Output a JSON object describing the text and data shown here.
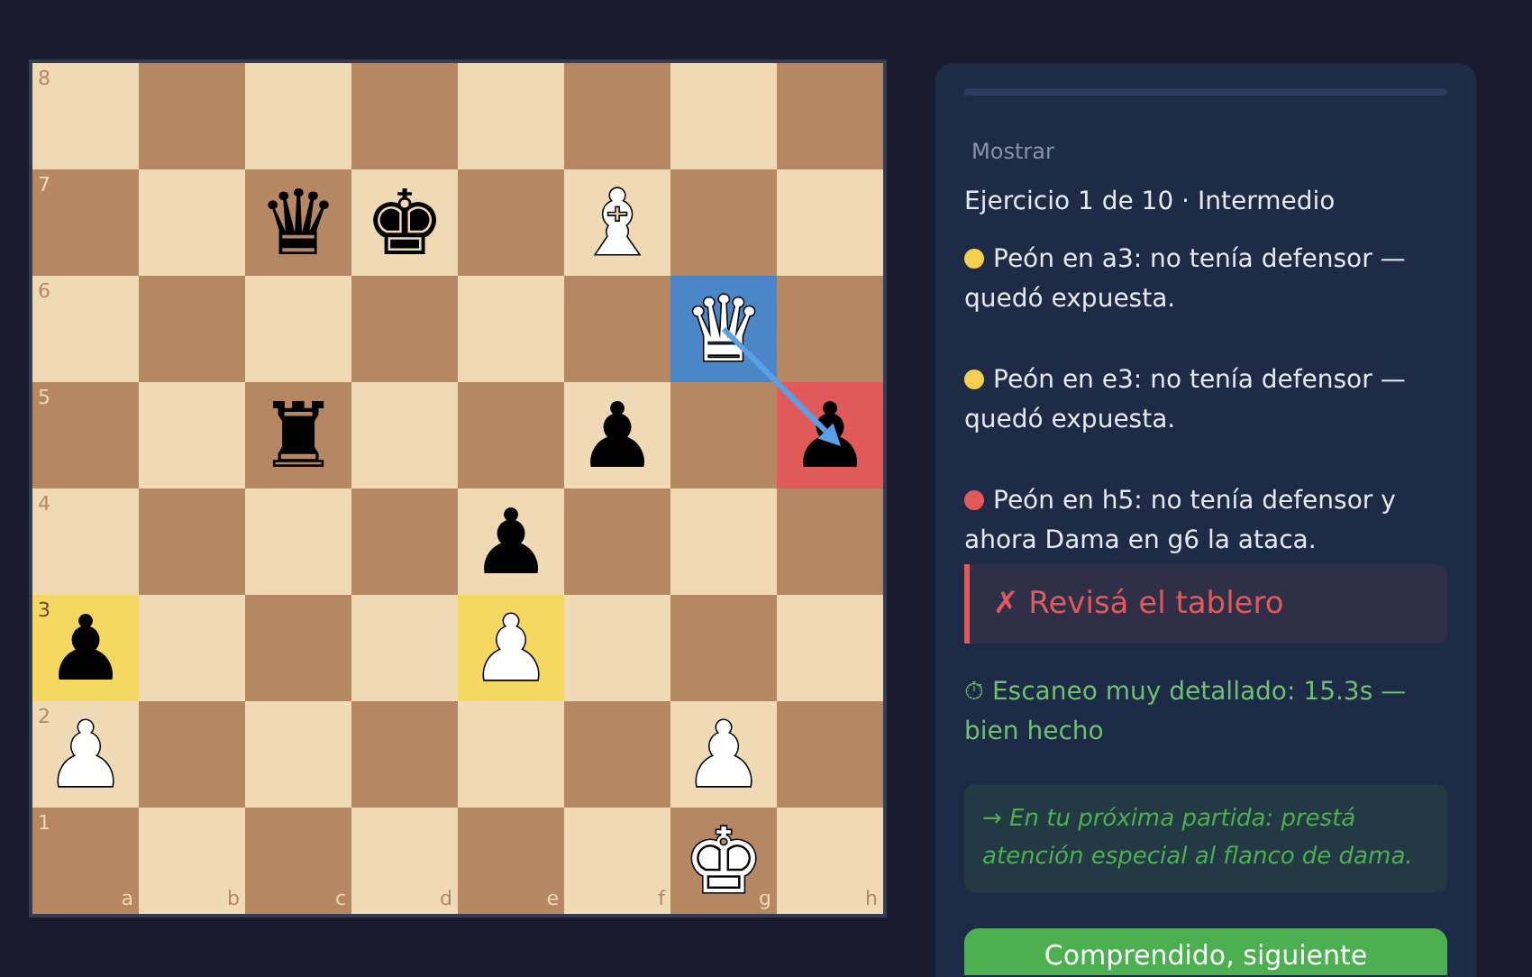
{
  "board": {
    "files": [
      "a",
      "b",
      "c",
      "d",
      "e",
      "f",
      "g",
      "h"
    ],
    "rows": [
      {
        "rank": "8",
        "squares": [
          {
            "color": "#f0d9b5"
          },
          {
            "color": "#b58863"
          },
          {
            "color": "#f0d9b5"
          },
          {
            "color": "#b58863"
          },
          {
            "color": "#f0d9b5"
          },
          {
            "color": "#b58863"
          },
          {
            "color": "#f0d9b5"
          },
          {
            "color": "#b58863"
          }
        ]
      },
      {
        "rank": "7",
        "squares": [
          {
            "color": "#b58863"
          },
          {
            "color": "#f0d9b5"
          },
          {
            "color": "#b58863",
            "piece": "♛",
            "kind": "black"
          },
          {
            "color": "#f0d9b5",
            "piece": "♚",
            "kind": "black"
          },
          {
            "color": "#b58863"
          },
          {
            "color": "#f0d9b5",
            "piece": "♝",
            "kind": "white"
          },
          {
            "color": "#b58863"
          },
          {
            "color": "#f0d9b5"
          }
        ]
      },
      {
        "rank": "6",
        "squares": [
          {
            "color": "#f0d9b5"
          },
          {
            "color": "#b58863"
          },
          {
            "color": "#f0d9b5"
          },
          {
            "color": "#b58863"
          },
          {
            "color": "#f0d9b5"
          },
          {
            "color": "#b58863"
          },
          {
            "color": "#4a86c8",
            "piece": "♛",
            "kind": "white",
            "arrow_from": true
          },
          {
            "color": "#b58863"
          }
        ]
      },
      {
        "rank": "5",
        "squares": [
          {
            "color": "#b58863"
          },
          {
            "color": "#f0d9b5"
          },
          {
            "color": "#b58863",
            "piece": "♜",
            "kind": "black"
          },
          {
            "color": "#f0d9b5"
          },
          {
            "color": "#b58863"
          },
          {
            "color": "#f0d9b5",
            "piece": "♟",
            "kind": "black"
          },
          {
            "color": "#b58863"
          },
          {
            "color": "#e05a5a",
            "piece": "♟",
            "kind": "black",
            "arrow_to": true
          }
        ]
      },
      {
        "rank": "4",
        "squares": [
          {
            "color": "#f0d9b5"
          },
          {
            "color": "#b58863"
          },
          {
            "color": "#f0d9b5"
          },
          {
            "color": "#b58863"
          },
          {
            "color": "#f0d9b5",
            "piece": "♟",
            "kind": "black"
          },
          {
            "color": "#b58863"
          },
          {
            "color": "#f0d9b5"
          },
          {
            "color": "#b58863"
          }
        ]
      },
      {
        "rank": "3",
        "squares": [
          {
            "color": "#f5d860",
            "piece": "♟",
            "kind": "black"
          },
          {
            "color": "#f0d9b5"
          },
          {
            "color": "#b58863"
          },
          {
            "color": "#f0d9b5"
          },
          {
            "color": "#f5d860",
            "piece": "♟",
            "kind": "white"
          },
          {
            "color": "#f0d9b5"
          },
          {
            "color": "#b58863"
          },
          {
            "color": "#f0d9b5"
          }
        ]
      },
      {
        "rank": "2",
        "squares": [
          {
            "color": "#f0d9b5",
            "piece": "♟",
            "kind": "white"
          },
          {
            "color": "#b58863"
          },
          {
            "color": "#f0d9b5"
          },
          {
            "color": "#b58863"
          },
          {
            "color": "#f0d9b5"
          },
          {
            "color": "#b58863"
          },
          {
            "color": "#f0d9b5",
            "piece": "♟",
            "kind": "white"
          },
          {
            "color": "#b58863"
          }
        ]
      },
      {
        "rank": "1",
        "squares": [
          {
            "color": "#b58863"
          },
          {
            "color": "#f0d9b5"
          },
          {
            "color": "#b58863"
          },
          {
            "color": "#f0d9b5"
          },
          {
            "color": "#b58863"
          },
          {
            "color": "#f0d9b5"
          },
          {
            "color": "#b58863",
            "piece": "♚",
            "kind": "white"
          },
          {
            "color": "#f0d9b5"
          }
        ]
      }
    ]
  },
  "panel": {
    "toggle": "Mostrar",
    "title": "Ejercicio 1 de 10 · Intermedio",
    "findings": [
      {
        "color": "#f5d050",
        "text": "Peón en a3: no tenía defensor — quedó expuesta."
      },
      {
        "color": "#f5d050",
        "text": "Peón en e3: no tenía defensor — quedó expuesta."
      },
      {
        "color": "#e05a5a",
        "text": "Peón en h5: no tenía defensor y ahora Dama en g6 la ataca."
      }
    ],
    "alert": "✗ Revisá el tablero",
    "timing": "⏱ Escaneo muy detallado: 15.3s — bien hecho",
    "tip": "→ En tu próxima partida: prestá atención especial al flanco de dama.",
    "button": "Comprendido, siguiente"
  }
}
